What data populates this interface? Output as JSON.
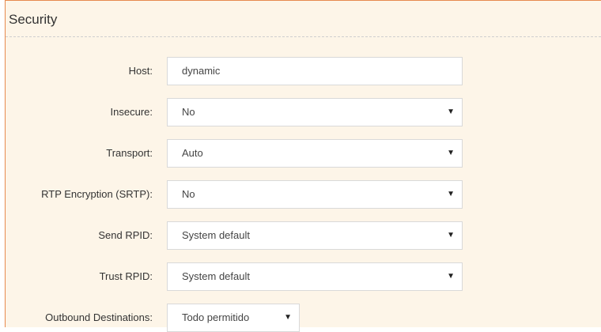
{
  "section": {
    "title": "Security"
  },
  "fields": {
    "host": {
      "label": "Host:",
      "value": "dynamic"
    },
    "insecure": {
      "label": "Insecure:",
      "value": "No"
    },
    "transport": {
      "label": "Transport:",
      "value": "Auto"
    },
    "srtp": {
      "label": "RTP Encryption (SRTP):",
      "value": "No"
    },
    "send_rpid": {
      "label": "Send RPID:",
      "value": "System default"
    },
    "trust_rpid": {
      "label": "Trust RPID:",
      "value": "System default"
    },
    "outbound": {
      "label": "Outbound Destinations:",
      "value": "Todo permitido"
    }
  },
  "icons": {
    "dropdown": "caret-down-icon",
    "caret_glyph": "▼"
  },
  "colors": {
    "panel_bg": "#fdf5e8",
    "panel_border": "#e78a4e"
  }
}
